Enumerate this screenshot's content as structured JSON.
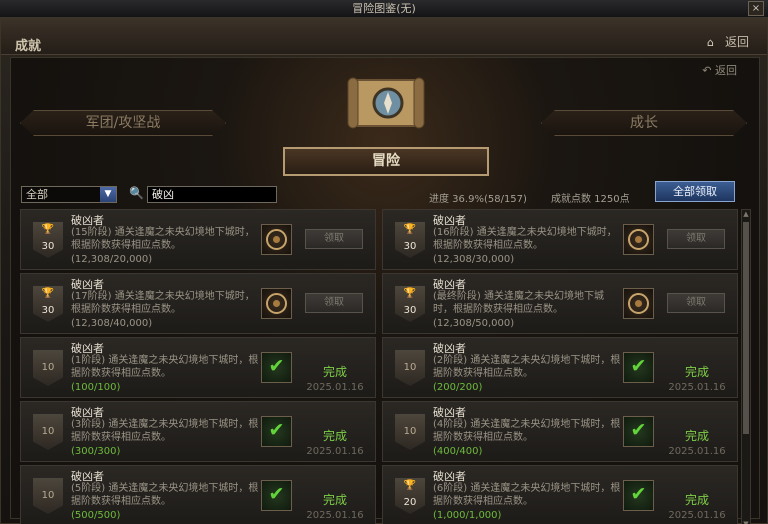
{
  "window": {
    "title": "冒险图鉴(无)",
    "close_label": "×"
  },
  "header": {
    "section_title": "成就",
    "home_icon": "home-icon",
    "back_label": "返回"
  },
  "panel": {
    "back_label": "返回",
    "back_icon": "undo-icon"
  },
  "tabs": {
    "left": "军团/攻坚战",
    "active": "冒险",
    "right": "成长"
  },
  "filter": {
    "selected": "全部",
    "search_value": "破凶"
  },
  "stats": {
    "progress": "进度 36.9%(58/157)",
    "points": "成就点数 1250点"
  },
  "claim_all_label": "全部领取",
  "cards": [
    {
      "title": "破凶者",
      "desc": "(15阶段) 通关逢魔之未央幻境地下城时，根据阶数获得相应点数。",
      "progress": "(12,308/20,000)",
      "points": "30",
      "badge": "silver",
      "state": "claimable",
      "claim_label": "领取"
    },
    {
      "title": "破凶者",
      "desc": "(16阶段) 通关逢魔之未央幻境地下城时，根据阶数获得相应点数。",
      "progress": "(12,308/30,000)",
      "points": "30",
      "badge": "silver",
      "state": "claimable",
      "claim_label": "领取"
    },
    {
      "title": "破凶者",
      "desc": "(17阶段) 通关逢魔之未央幻境地下城时，根据阶数获得相应点数。",
      "progress": "(12,308/40,000)",
      "points": "30",
      "badge": "silver",
      "state": "claimable",
      "claim_label": "领取"
    },
    {
      "title": "破凶者",
      "desc": "(最终阶段) 通关逢魔之未央幻境地下城时，根据阶数获得相应点数。",
      "progress": "(12,308/50,000)",
      "points": "30",
      "badge": "silver",
      "state": "claimable",
      "claim_label": "领取"
    },
    {
      "title": "破凶者",
      "desc": "(1阶段) 通关逢魔之未央幻境地下城时，根据阶数获得相应点数。",
      "progress": "(100/100)",
      "points": "10",
      "badge": "plain",
      "state": "done",
      "done_label": "完成",
      "date": "2025.01.16"
    },
    {
      "title": "破凶者",
      "desc": "(2阶段) 通关逢魔之未央幻境地下城时，根据阶数获得相应点数。",
      "progress": "(200/200)",
      "points": "10",
      "badge": "plain",
      "state": "done",
      "done_label": "完成",
      "date": "2025.01.16"
    },
    {
      "title": "破凶者",
      "desc": "(3阶段) 通关逢魔之未央幻境地下城时，根据阶数获得相应点数。",
      "progress": "(300/300)",
      "points": "10",
      "badge": "plain",
      "state": "done",
      "done_label": "完成",
      "date": "2025.01.16"
    },
    {
      "title": "破凶者",
      "desc": "(4阶段) 通关逢魔之未央幻境地下城时，根据阶数获得相应点数。",
      "progress": "(400/400)",
      "points": "10",
      "badge": "plain",
      "state": "done",
      "done_label": "完成",
      "date": "2025.01.16"
    },
    {
      "title": "破凶者",
      "desc": "(5阶段) 通关逢魔之未央幻境地下城时，根据阶数获得相应点数。",
      "progress": "(500/500)",
      "points": "10",
      "badge": "plain",
      "state": "done",
      "done_label": "完成",
      "date": "2025.01.16"
    },
    {
      "title": "破凶者",
      "desc": "(6阶段) 通关逢魔之未央幻境地下城时，根据阶数获得相应点数。",
      "progress": "(1,000/1,000)",
      "points": "20",
      "badge": "silver",
      "state": "done",
      "done_label": "完成",
      "date": "2025.01.16"
    }
  ]
}
